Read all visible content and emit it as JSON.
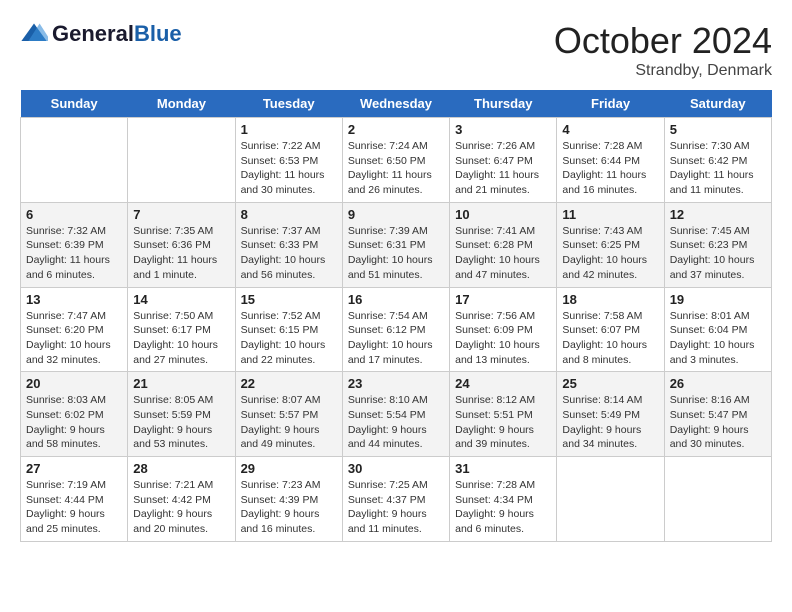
{
  "header": {
    "logo_general": "General",
    "logo_blue": "Blue",
    "title": "October 2024",
    "location": "Strandby, Denmark"
  },
  "days_of_week": [
    "Sunday",
    "Monday",
    "Tuesday",
    "Wednesday",
    "Thursday",
    "Friday",
    "Saturday"
  ],
  "weeks": [
    [
      {
        "day": "",
        "info": ""
      },
      {
        "day": "",
        "info": ""
      },
      {
        "day": "1",
        "info": "Sunrise: 7:22 AM\nSunset: 6:53 PM\nDaylight: 11 hours and 30 minutes."
      },
      {
        "day": "2",
        "info": "Sunrise: 7:24 AM\nSunset: 6:50 PM\nDaylight: 11 hours and 26 minutes."
      },
      {
        "day": "3",
        "info": "Sunrise: 7:26 AM\nSunset: 6:47 PM\nDaylight: 11 hours and 21 minutes."
      },
      {
        "day": "4",
        "info": "Sunrise: 7:28 AM\nSunset: 6:44 PM\nDaylight: 11 hours and 16 minutes."
      },
      {
        "day": "5",
        "info": "Sunrise: 7:30 AM\nSunset: 6:42 PM\nDaylight: 11 hours and 11 minutes."
      }
    ],
    [
      {
        "day": "6",
        "info": "Sunrise: 7:32 AM\nSunset: 6:39 PM\nDaylight: 11 hours and 6 minutes."
      },
      {
        "day": "7",
        "info": "Sunrise: 7:35 AM\nSunset: 6:36 PM\nDaylight: 11 hours and 1 minute."
      },
      {
        "day": "8",
        "info": "Sunrise: 7:37 AM\nSunset: 6:33 PM\nDaylight: 10 hours and 56 minutes."
      },
      {
        "day": "9",
        "info": "Sunrise: 7:39 AM\nSunset: 6:31 PM\nDaylight: 10 hours and 51 minutes."
      },
      {
        "day": "10",
        "info": "Sunrise: 7:41 AM\nSunset: 6:28 PM\nDaylight: 10 hours and 47 minutes."
      },
      {
        "day": "11",
        "info": "Sunrise: 7:43 AM\nSunset: 6:25 PM\nDaylight: 10 hours and 42 minutes."
      },
      {
        "day": "12",
        "info": "Sunrise: 7:45 AM\nSunset: 6:23 PM\nDaylight: 10 hours and 37 minutes."
      }
    ],
    [
      {
        "day": "13",
        "info": "Sunrise: 7:47 AM\nSunset: 6:20 PM\nDaylight: 10 hours and 32 minutes."
      },
      {
        "day": "14",
        "info": "Sunrise: 7:50 AM\nSunset: 6:17 PM\nDaylight: 10 hours and 27 minutes."
      },
      {
        "day": "15",
        "info": "Sunrise: 7:52 AM\nSunset: 6:15 PM\nDaylight: 10 hours and 22 minutes."
      },
      {
        "day": "16",
        "info": "Sunrise: 7:54 AM\nSunset: 6:12 PM\nDaylight: 10 hours and 17 minutes."
      },
      {
        "day": "17",
        "info": "Sunrise: 7:56 AM\nSunset: 6:09 PM\nDaylight: 10 hours and 13 minutes."
      },
      {
        "day": "18",
        "info": "Sunrise: 7:58 AM\nSunset: 6:07 PM\nDaylight: 10 hours and 8 minutes."
      },
      {
        "day": "19",
        "info": "Sunrise: 8:01 AM\nSunset: 6:04 PM\nDaylight: 10 hours and 3 minutes."
      }
    ],
    [
      {
        "day": "20",
        "info": "Sunrise: 8:03 AM\nSunset: 6:02 PM\nDaylight: 9 hours and 58 minutes."
      },
      {
        "day": "21",
        "info": "Sunrise: 8:05 AM\nSunset: 5:59 PM\nDaylight: 9 hours and 53 minutes."
      },
      {
        "day": "22",
        "info": "Sunrise: 8:07 AM\nSunset: 5:57 PM\nDaylight: 9 hours and 49 minutes."
      },
      {
        "day": "23",
        "info": "Sunrise: 8:10 AM\nSunset: 5:54 PM\nDaylight: 9 hours and 44 minutes."
      },
      {
        "day": "24",
        "info": "Sunrise: 8:12 AM\nSunset: 5:51 PM\nDaylight: 9 hours and 39 minutes."
      },
      {
        "day": "25",
        "info": "Sunrise: 8:14 AM\nSunset: 5:49 PM\nDaylight: 9 hours and 34 minutes."
      },
      {
        "day": "26",
        "info": "Sunrise: 8:16 AM\nSunset: 5:47 PM\nDaylight: 9 hours and 30 minutes."
      }
    ],
    [
      {
        "day": "27",
        "info": "Sunrise: 7:19 AM\nSunset: 4:44 PM\nDaylight: 9 hours and 25 minutes."
      },
      {
        "day": "28",
        "info": "Sunrise: 7:21 AM\nSunset: 4:42 PM\nDaylight: 9 hours and 20 minutes."
      },
      {
        "day": "29",
        "info": "Sunrise: 7:23 AM\nSunset: 4:39 PM\nDaylight: 9 hours and 16 minutes."
      },
      {
        "day": "30",
        "info": "Sunrise: 7:25 AM\nSunset: 4:37 PM\nDaylight: 9 hours and 11 minutes."
      },
      {
        "day": "31",
        "info": "Sunrise: 7:28 AM\nSunset: 4:34 PM\nDaylight: 9 hours and 6 minutes."
      },
      {
        "day": "",
        "info": ""
      },
      {
        "day": "",
        "info": ""
      }
    ]
  ]
}
